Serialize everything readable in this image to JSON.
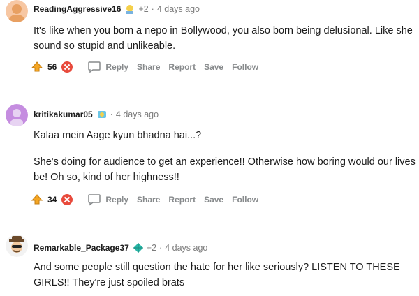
{
  "comments": [
    {
      "username": "ReadingAggressive16",
      "extra": "+2",
      "separator": "·",
      "time": "4 days ago",
      "body": [
        "It's like when you born a nepo in Bollywood, you also born being delusional. Like she sound so stupid and unlikeable."
      ],
      "score": "56",
      "actions": {
        "reply": "Reply",
        "share": "Share",
        "report": "Report",
        "save": "Save",
        "follow": "Follow"
      },
      "avatar_color": "#e8a062",
      "flair_icon": "award-icon"
    },
    {
      "username": "kritikakumar05",
      "extra": "",
      "separator": "·",
      "time": "4 days ago",
      "body": [
        "Kalaa mein Aage kyun bhadna hai...?",
        "She's doing for audience to get an experience!! Otherwise how boring would our lives be! Oh so, kind of her highness!!"
      ],
      "score": "34",
      "actions": {
        "reply": "Reply",
        "share": "Share",
        "report": "Report",
        "save": "Save",
        "follow": "Follow"
      },
      "avatar_color": "#c58de0",
      "flair_icon": "award-icon"
    },
    {
      "username": "Remarkable_Package37",
      "extra": "+2",
      "separator": "·",
      "time": "4 days ago",
      "body": [
        "And some people still question the hate for her like seriously? LISTEN TO THESE GIRLS!! They're just spoiled brats"
      ],
      "avatar_color": "#f2f2f2",
      "flair_icon": "diamond-icon"
    }
  ],
  "colors": {
    "upvote": "#f5a623",
    "downvote": "#e84a3c",
    "meta": "#7c7c7c"
  }
}
